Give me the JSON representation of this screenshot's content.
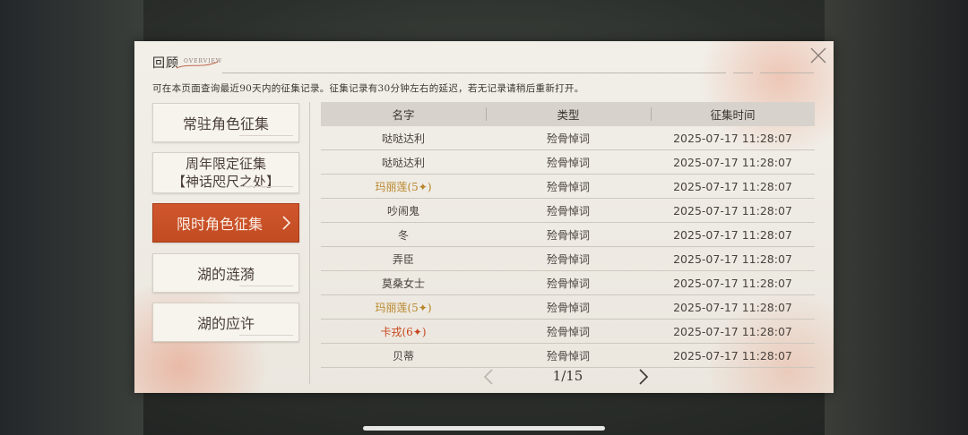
{
  "header": {
    "title": "回顾",
    "subtitle": "OVERVIEW",
    "notice": "可在本页面查询最近90天内的征集记录。征集记录有30分钟左右的延迟，若无记录请稍后重新打开。"
  },
  "sidebar": {
    "items": [
      {
        "label": "常驻角色征集"
      },
      {
        "label_line1": "周年限定征集",
        "label_line2": "【神话咫尺之处】"
      },
      {
        "label": "限时角色征集",
        "active": true
      },
      {
        "label": "湖的涟漪"
      },
      {
        "label": "湖的应许"
      }
    ]
  },
  "table": {
    "headers": [
      "名字",
      "类型",
      "征集时间"
    ],
    "rows": [
      {
        "name": "哒哒达利",
        "type": "殓骨悼词",
        "time": "2025-07-17 11:28:07",
        "rarity": "normal"
      },
      {
        "name": "哒哒达利",
        "type": "殓骨悼词",
        "time": "2025-07-17 11:28:07",
        "rarity": "normal"
      },
      {
        "name": "玛丽莲(5✦)",
        "type": "殓骨悼词",
        "time": "2025-07-17 11:28:07",
        "rarity": "5star"
      },
      {
        "name": "吵闹鬼",
        "type": "殓骨悼词",
        "time": "2025-07-17 11:28:07",
        "rarity": "normal"
      },
      {
        "name": "冬",
        "type": "殓骨悼词",
        "time": "2025-07-17 11:28:07",
        "rarity": "normal"
      },
      {
        "name": "弄臣",
        "type": "殓骨悼词",
        "time": "2025-07-17 11:28:07",
        "rarity": "normal"
      },
      {
        "name": "莫桑女士",
        "type": "殓骨悼词",
        "time": "2025-07-17 11:28:07",
        "rarity": "normal"
      },
      {
        "name": "玛丽莲(5✦)",
        "type": "殓骨悼词",
        "time": "2025-07-17 11:28:07",
        "rarity": "5star"
      },
      {
        "name": "卡戎(6✦)",
        "type": "殓骨悼词",
        "time": "2025-07-17 11:28:07",
        "rarity": "6star"
      },
      {
        "name": "贝蒂",
        "type": "殓骨悼词",
        "time": "2025-07-17 11:28:07",
        "rarity": "normal"
      }
    ]
  },
  "pagination": {
    "text": "1/15"
  },
  "colors": {
    "accent": "#c8512a",
    "rarity_5": "#b8862a",
    "rarity_6": "#c8461e",
    "text": "#4a423d"
  },
  "icons": {
    "close": "close-icon",
    "prev": "chevron-left-icon",
    "next": "chevron-right-icon"
  }
}
